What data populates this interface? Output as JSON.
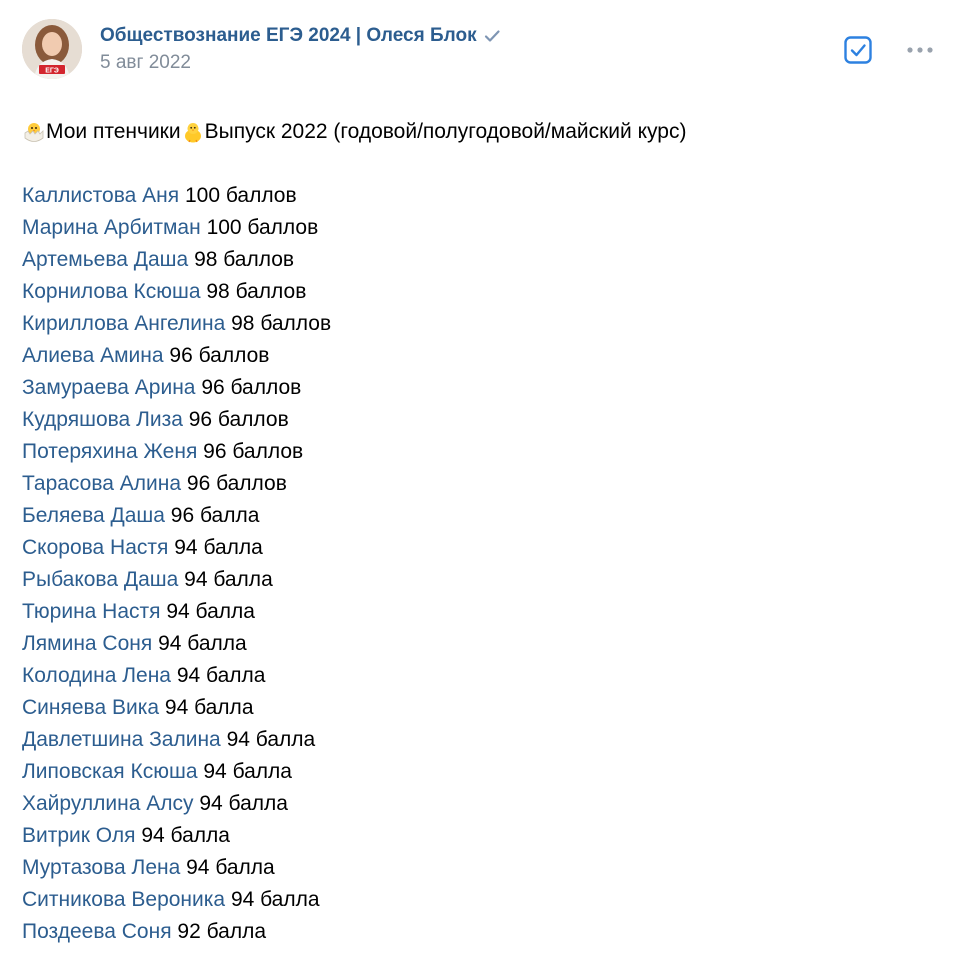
{
  "post": {
    "author": "Обществознание ЕГЭ 2024 | Олеся Блок",
    "date": "5 авг 2022",
    "avatar_text": "ЕГЭ",
    "intro_part1": "Мои птенчики ",
    "intro_part2": "Выпуск 2022 (годовой/полугодовой/майский курс)"
  },
  "icons": {
    "verified": "verified-check-icon",
    "check": "checkbox-icon",
    "more": "more-dots-icon",
    "chick1": "hatching-chick-emoji",
    "chick2": "baby-chick-emoji"
  },
  "colors": {
    "link": "#2c5d8f",
    "muted": "#818c99",
    "accent": "#2d81e0"
  },
  "students": [
    {
      "name": "Каллистова Аня",
      "score": "100 баллов"
    },
    {
      "name": "Марина Арбитман",
      "score": "100 баллов"
    },
    {
      "name": "Артемьева Даша",
      "score": "98 баллов"
    },
    {
      "name": "Корнилова Ксюша",
      "score": "98 баллов"
    },
    {
      "name": "Кириллова Ангелина",
      "score": "98 баллов"
    },
    {
      "name": "Алиева Амина",
      "score": "96 баллов"
    },
    {
      "name": "Замураева Арина",
      "score": "96 баллов"
    },
    {
      "name": "Кудряшова Лиза",
      "score": "96 баллов"
    },
    {
      "name": "Потеряхина Женя",
      "score": "96 баллов"
    },
    {
      "name": "Тарасова Алина",
      "score": "96 баллов"
    },
    {
      "name": "Беляева Даша",
      "score": "96 балла"
    },
    {
      "name": "Скорова Настя",
      "score": "94 балла"
    },
    {
      "name": "Рыбакова Даша",
      "score": "94 балла"
    },
    {
      "name": "Тюрина Настя",
      "score": "94 балла"
    },
    {
      "name": "Лямина Соня",
      "score": "94 балла"
    },
    {
      "name": "Колодина Лена",
      "score": "94 балла"
    },
    {
      "name": "Синяева Вика",
      "score": "94 балла"
    },
    {
      "name": "Давлетшина Залина",
      "score": "94 балла"
    },
    {
      "name": "Липовская Ксюша",
      "score": "94 балла"
    },
    {
      "name": "Хайруллина Алсу",
      "score": "94 балла"
    },
    {
      "name": "Витрик Оля",
      "score": "94 балла"
    },
    {
      "name": "Муртазова Лена",
      "score": "94 балла"
    },
    {
      "name": "Ситникова Вероника",
      "score": "94 балла"
    },
    {
      "name": "Поздеева Соня",
      "score": "92 балла"
    }
  ]
}
